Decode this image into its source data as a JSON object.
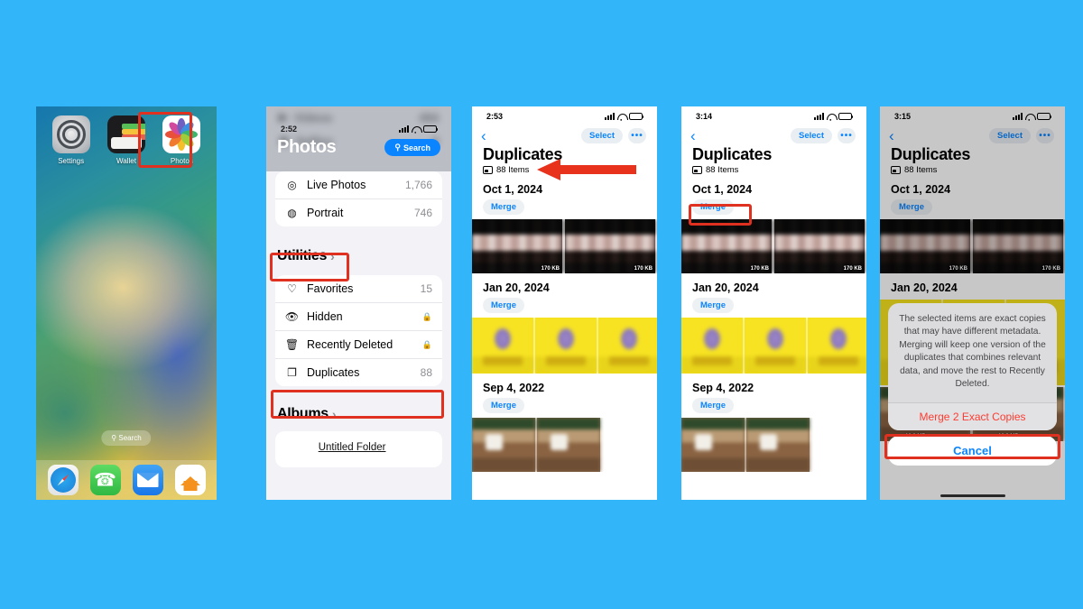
{
  "meta": {
    "background_color": "#33b5f9",
    "highlight_color": "#e03020"
  },
  "panel1": {
    "name": "iphone-home-screen",
    "apps": [
      {
        "label": "Settings",
        "icon": "settings-gear-icon"
      },
      {
        "label": "Wallet",
        "icon": "wallet-icon"
      },
      {
        "label": "Photos",
        "icon": "photos-icon",
        "highlighted": true
      }
    ],
    "search_pill": "Search",
    "dock": [
      {
        "label": "Safari",
        "icon": "safari-icon"
      },
      {
        "label": "Phone",
        "icon": "phone-icon"
      },
      {
        "label": "Mail",
        "icon": "mail-icon"
      },
      {
        "label": "Home",
        "icon": "home-app-icon"
      }
    ]
  },
  "panel2": {
    "name": "photos-library-list",
    "status": {
      "time": "2:52",
      "battery": "low"
    },
    "header_title": "Photos",
    "search_button": "Search",
    "ghost_rows": [
      {
        "label": "Videos",
        "count": "494"
      },
      {
        "label": "Selfies",
        "count": "9"
      }
    ],
    "media_types": [
      {
        "icon": "live-photos-icon",
        "label": "Live Photos",
        "count": "1,766"
      },
      {
        "icon": "portrait-icon",
        "label": "Portrait",
        "count": "746"
      }
    ],
    "utilities_header": "Utilities",
    "utilities": [
      {
        "icon": "heart-icon",
        "label": "Favorites",
        "count": "15",
        "locked": false
      },
      {
        "icon": "eye-slash-icon",
        "label": "Hidden",
        "count": "",
        "locked": true
      },
      {
        "icon": "trash-icon",
        "label": "Recently Deleted",
        "count": "",
        "locked": true
      },
      {
        "icon": "duplicates-icon",
        "label": "Duplicates",
        "count": "88",
        "locked": false,
        "highlighted": true
      }
    ],
    "albums_header": "Albums",
    "album_name": "Untitled Folder"
  },
  "panel3": {
    "name": "duplicates-screen-overview",
    "status": {
      "time": "2:53",
      "battery": "normal"
    },
    "nav": {
      "back": "‹",
      "select": "Select",
      "more": "•••"
    },
    "title": "Duplicates",
    "subtitle": "88 Items",
    "groups": [
      {
        "date": "Oct 1, 2024",
        "merge": "Merge",
        "style": "dark",
        "thumbs": [
          "170 KB",
          "170 KB"
        ]
      },
      {
        "date": "Jan 20, 2024",
        "merge": "Merge",
        "style": "yellow",
        "thumbs": [
          "",
          "",
          ""
        ]
      },
      {
        "date": "Sep 4, 2022",
        "merge": "Merge",
        "style": "wood",
        "thumbs": [
          "",
          ""
        ]
      }
    ]
  },
  "panel4": {
    "name": "duplicates-screen-merge-highlight",
    "status": {
      "time": "3:14",
      "battery": "low"
    },
    "nav": {
      "back": "‹",
      "select": "Select",
      "more": "•••"
    },
    "title": "Duplicates",
    "subtitle": "88 Items",
    "groups": [
      {
        "date": "Oct 1, 2024",
        "merge": "Merge",
        "style": "dark",
        "thumbs": [
          "170 KB",
          "170 KB"
        ],
        "highlighted": true
      },
      {
        "date": "Jan 20, 2024",
        "merge": "Merge",
        "style": "yellow",
        "thumbs": [
          "",
          "",
          ""
        ]
      },
      {
        "date": "Sep 4, 2022",
        "merge": "Merge",
        "style": "wood",
        "thumbs": [
          "",
          ""
        ]
      }
    ]
  },
  "panel5": {
    "name": "duplicates-screen-merge-confirm",
    "status": {
      "time": "3:15",
      "battery": "low"
    },
    "nav": {
      "back": "‹",
      "select": "Select",
      "more": "•••"
    },
    "title": "Duplicates",
    "subtitle": "88 Items",
    "groups": [
      {
        "date": "Oct 1, 2024",
        "merge": "Merge",
        "style": "dark",
        "thumbs": [
          "170 KB",
          "170 KB"
        ]
      },
      {
        "date": "Jan 20, 2024",
        "merge": "Merge",
        "style": "yellow",
        "thumbs": [
          "",
          "",
          ""
        ]
      }
    ],
    "alert": {
      "message": "The selected items are exact copies that may have different metadata. Merging will keep one version of the duplicates that combines relevant data, and move the rest to Recently Deleted.",
      "confirm": "Merge 2 Exact Copies",
      "cancel": "Cancel",
      "confirm_highlighted": true
    },
    "bottom_sizes": [
      "10.3 MB",
      "10.3 MB"
    ]
  }
}
